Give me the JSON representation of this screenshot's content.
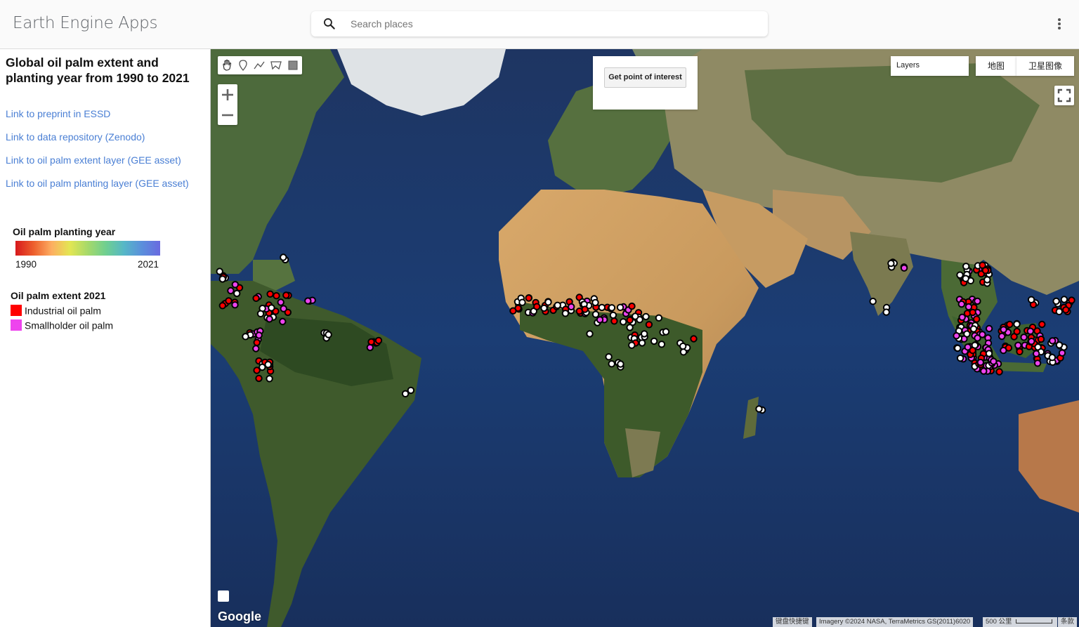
{
  "app": {
    "title": "Earth Engine Apps"
  },
  "search": {
    "placeholder": "Search places"
  },
  "panel": {
    "title": "Global oil palm extent and planting year from 1990 to 2021",
    "links": [
      "Link to preprint in ESSD",
      "Link to data repository (Zenodo)",
      "Link to oil palm extent layer (GEE asset)",
      "Link to oil palm planting layer (GEE asset)"
    ],
    "planting_legend": {
      "title": "Oil palm planting year",
      "min": "1990",
      "max": "2021"
    },
    "extent_legend": {
      "title": "Oil palm extent 2021",
      "items": [
        {
          "label": "Industrial oil palm",
          "color": "#ff0000"
        },
        {
          "label": "Smallholder oil palm",
          "color": "#ee44ee"
        }
      ]
    }
  },
  "map": {
    "poi_button": "Get point of interest",
    "layers_label": "Layers",
    "map_types": [
      "地图",
      "卫星图像"
    ],
    "google_logo": "Google",
    "attribution": {
      "shortcuts": "键盘快捷键",
      "imagery": "Imagery ©2024 NASA, TerraMetrics GS(2011)6020",
      "scale": "500 公里",
      "terms": "条款"
    },
    "colors": {
      "ocean": "#1d3a6b",
      "industrial": "#ff0000",
      "smallholder": "#ee44ee",
      "white_point": "#ffffff"
    }
  }
}
